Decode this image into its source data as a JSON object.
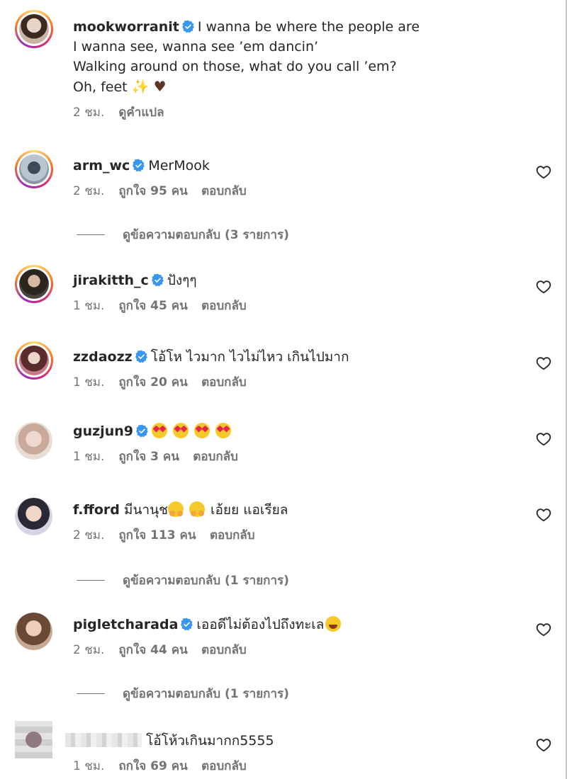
{
  "caption": {
    "username": "mookworranit",
    "lines": [
      "I wanna be where the people are",
      "I wanna see, wanna see ’em dancin’",
      "Walking around on those, what do you call ’em?",
      "Oh, feet"
    ],
    "emoji_end": [
      "sparkles",
      "brown-heart"
    ],
    "time": "2 ชม.",
    "translate": "ดูคำแปล"
  },
  "comments": [
    {
      "username": "arm_wc",
      "verified": true,
      "text": "MerMook",
      "time": "2 ชม.",
      "likes": "ถูกใจ 95 คน",
      "reply": "ตอบกลับ",
      "view_replies": "ดูข้อความตอบกลับ (3 รายการ)"
    },
    {
      "username": "jirakitth_c",
      "verified": true,
      "text": "ปังๆๆ",
      "time": "1 ชม.",
      "likes": "ถูกใจ 45 คน",
      "reply": "ตอบกลับ"
    },
    {
      "username": "zzdaozz",
      "verified": true,
      "text": "โอ้โห ไวมาก ไวไม่ไหว เกินไปมาก",
      "time": "1 ชม.",
      "likes": "ถูกใจ 20 คน",
      "reply": "ตอบกลับ"
    },
    {
      "username": "guzjun9",
      "verified": true,
      "text": "",
      "time": "1 ชม.",
      "likes": "ถูกใจ 3 คน",
      "reply": "ตอบกลับ"
    },
    {
      "username": "f.fford",
      "verified": false,
      "text_a": "มีนานุช",
      "text_b": "เอ้ยย แอเรียล",
      "time": "2 ชม.",
      "likes": "ถูกใจ 113 คน",
      "reply": "ตอบกลับ",
      "view_replies": "ดูข้อความตอบกลับ (1 รายการ)"
    },
    {
      "username": "pigletcharada",
      "verified": true,
      "text": "เออดีไม่ต้องไปถึงทะเล",
      "time": "2 ชม.",
      "likes": "ถูกใจ 44 คน",
      "reply": "ตอบกลับ",
      "view_replies": "ดูข้อความตอบกลับ (1 รายการ)"
    },
    {
      "username": "",
      "verified": false,
      "text": "โอ้โห้วเกินมากก5555",
      "time": "1 ชม.",
      "likes": "ถกใจ 69 คน",
      "reply": "ตอบกลับ"
    }
  ],
  "colors": {
    "verified": "#3897f0",
    "meta": "#737373",
    "text": "#262626"
  }
}
